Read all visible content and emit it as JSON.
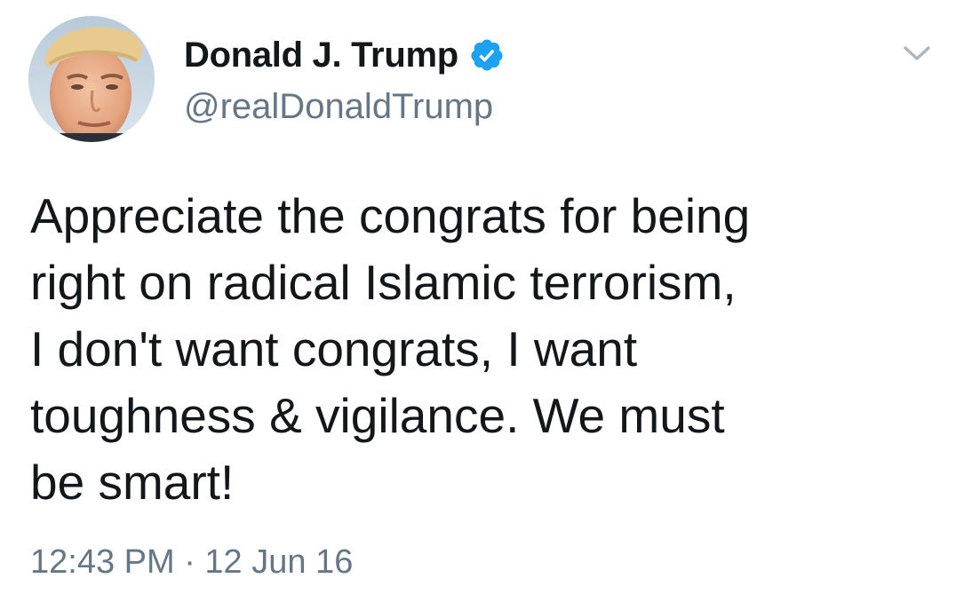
{
  "user": {
    "display_name": "Donald J. Trump",
    "handle": "@realDonaldTrump",
    "verified": true,
    "avatar_icon": "profile-photo"
  },
  "menu": {
    "caret_icon": "chevron-down-icon"
  },
  "tweet": {
    "lines": [
      "Appreciate the congrats for being",
      "right on radical Islamic terrorism,",
      "I don't want congrats, I want",
      "toughness & vigilance. We must",
      "be smart!"
    ],
    "timestamp": "12:43 PM · 12 Jun 16"
  },
  "colors": {
    "text_primary": "#14171a",
    "text_secondary": "#657786",
    "verified_blue": "#1da1f2",
    "background": "#ffffff"
  }
}
